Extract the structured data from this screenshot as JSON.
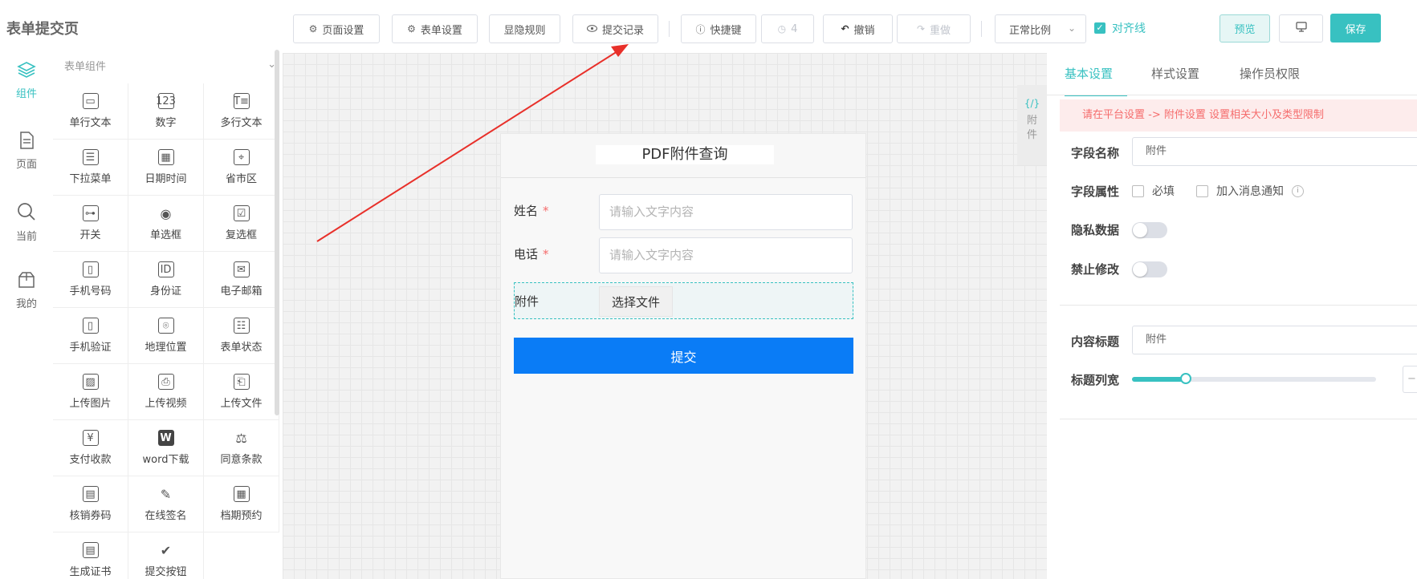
{
  "app": {
    "title": "表单提交页"
  },
  "toolbar": {
    "page_settings": "页面设置",
    "form_settings": "表单设置",
    "visibility_rules": "显隐规则",
    "submit_records": "提交记录",
    "shortcuts": "快捷键",
    "history_count": "4",
    "undo": "撤销",
    "redo": "重做",
    "zoom": "正常比例",
    "align_lines": "对齐线",
    "preview": "预览",
    "save": "保存"
  },
  "rail": [
    {
      "label": "组件",
      "icon": "layers-icon",
      "active": true
    },
    {
      "label": "页面",
      "icon": "page-icon",
      "active": false
    },
    {
      "label": "当前",
      "icon": "search-icon",
      "active": false
    },
    {
      "label": "我的",
      "icon": "box-icon",
      "active": false
    }
  ],
  "components": {
    "header": "表单组件",
    "items": [
      {
        "label": "单行文本",
        "icon": "single-line-icon"
      },
      {
        "label": "数字",
        "icon": "number-icon"
      },
      {
        "label": "多行文本",
        "icon": "multi-line-icon"
      },
      {
        "label": "下拉菜单",
        "icon": "dropdown-icon"
      },
      {
        "label": "日期时间",
        "icon": "calendar-icon"
      },
      {
        "label": "省市区",
        "icon": "map-pin-icon"
      },
      {
        "label": "开关",
        "icon": "switch-icon"
      },
      {
        "label": "单选框",
        "icon": "radio-icon"
      },
      {
        "label": "复选框",
        "icon": "checkbox-icon"
      },
      {
        "label": "手机号码",
        "icon": "mobile-icon"
      },
      {
        "label": "身份证",
        "icon": "id-card-icon"
      },
      {
        "label": "电子邮箱",
        "icon": "mail-icon"
      },
      {
        "label": "手机验证",
        "icon": "mobile-verify-icon"
      },
      {
        "label": "地理位置",
        "icon": "location-icon"
      },
      {
        "label": "表单状态",
        "icon": "status-icon"
      },
      {
        "label": "上传图片",
        "icon": "image-icon"
      },
      {
        "label": "上传视频",
        "icon": "camera-icon"
      },
      {
        "label": "上传文件",
        "icon": "folder-upload-icon"
      },
      {
        "label": "支付收款",
        "icon": "payment-icon"
      },
      {
        "label": "word下载",
        "icon": "word-icon"
      },
      {
        "label": "同意条款",
        "icon": "gavel-icon"
      },
      {
        "label": "核销券码",
        "icon": "coupon-icon"
      },
      {
        "label": "在线签名",
        "icon": "feather-icon"
      },
      {
        "label": "档期预约",
        "icon": "schedule-icon"
      },
      {
        "label": "生成证书",
        "icon": "certificate-icon"
      },
      {
        "label": "提交按钮",
        "icon": "check-icon"
      }
    ]
  },
  "form": {
    "title": "PDF附件查询",
    "fields": [
      {
        "label": "姓名",
        "required": "*",
        "placeholder": "请输入文字内容"
      },
      {
        "label": "电话",
        "required": "*",
        "placeholder": "请输入文字内容"
      }
    ],
    "attachment": {
      "label": "附件",
      "button": "选择文件"
    },
    "submit": "提交"
  },
  "side_tab": {
    "code": "{/}",
    "label": "附件"
  },
  "properties": {
    "tabs": [
      "基本设置",
      "样式设置",
      "操作员权限"
    ],
    "tip": "请在平台设置 -> 附件设置 设置相关大小及类型限制",
    "field_name_label": "字段名称",
    "field_name_value": "附件",
    "field_attr_label": "字段属性",
    "required_option": "必填",
    "notify_option": "加入消息通知",
    "private_label": "隐私数据",
    "readonly_label": "禁止修改",
    "content_title_label": "内容标题",
    "content_title_value": "附件",
    "title_width_label": "标题列宽",
    "title_width_fraction": 0.22
  },
  "colors": {
    "accent": "#38c1c1",
    "submit_blue": "#0a7cf6",
    "arrow_red": "#e8302a",
    "tip_red": "#f56c6c"
  }
}
